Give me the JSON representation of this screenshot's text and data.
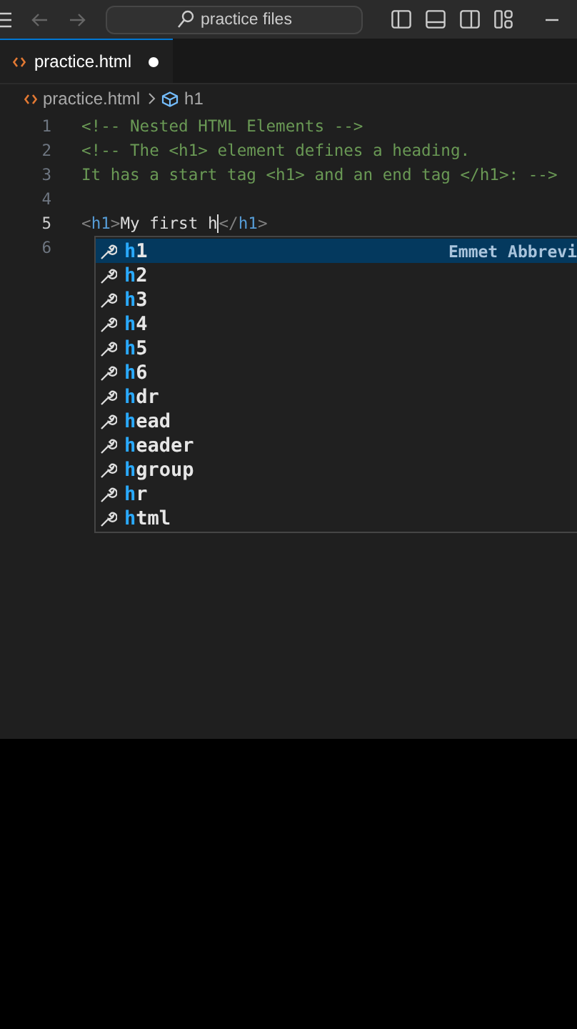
{
  "title_bar": {
    "search": "practice files"
  },
  "tabs": [
    {
      "label": "practice.html",
      "selected": true,
      "modified": true
    }
  ],
  "breadcrumb": {
    "file": "practice.html",
    "symbol": "h1"
  },
  "editor": {
    "lines": [
      {
        "number": "1",
        "current": false,
        "segments": [
          {
            "kind": "comment",
            "text": "<!-- Nested HTML Elements -->"
          }
        ]
      },
      {
        "number": "2",
        "current": false,
        "segments": [
          {
            "kind": "comment",
            "text": "<!-- The <h1> element defines a heading."
          }
        ]
      },
      {
        "number": "3",
        "current": false,
        "segments": [
          {
            "kind": "comment",
            "text": "It has a start tag <h1> and an end tag </h1>: -->"
          }
        ]
      },
      {
        "number": "4",
        "current": false
      },
      {
        "number": "5",
        "current": true,
        "segments": [
          {
            "kind": "punct",
            "text": "<"
          },
          {
            "kind": "tag",
            "text": "h1"
          },
          {
            "kind": "punct",
            "text": ">"
          },
          {
            "kind": "text",
            "text": "My first h",
            "caret": true
          },
          {
            "kind": "punct",
            "text": "</"
          },
          {
            "kind": "tag",
            "text": "h1"
          },
          {
            "kind": "punct",
            "text": ">"
          }
        ]
      },
      {
        "number": "6",
        "current": false
      }
    ]
  },
  "suggestions": [
    {
      "match": "h",
      "rest": "1",
      "selected": true,
      "detail": "Emmet Abbrevi"
    },
    {
      "match": "h",
      "rest": "2",
      "selected": false
    },
    {
      "match": "h",
      "rest": "3",
      "selected": false
    },
    {
      "match": "h",
      "rest": "4",
      "selected": false
    },
    {
      "match": "h",
      "rest": "5",
      "selected": false
    },
    {
      "match": "h",
      "rest": "6",
      "selected": false
    },
    {
      "match": "h",
      "rest": "dr",
      "selected": false
    },
    {
      "match": "h",
      "rest": "ead",
      "selected": false
    },
    {
      "match": "h",
      "rest": "eader",
      "selected": false
    },
    {
      "match": "h",
      "rest": "group",
      "selected": false
    },
    {
      "match": "h",
      "rest": "r",
      "selected": false
    },
    {
      "match": "h",
      "rest": "tml",
      "selected": false
    }
  ]
}
